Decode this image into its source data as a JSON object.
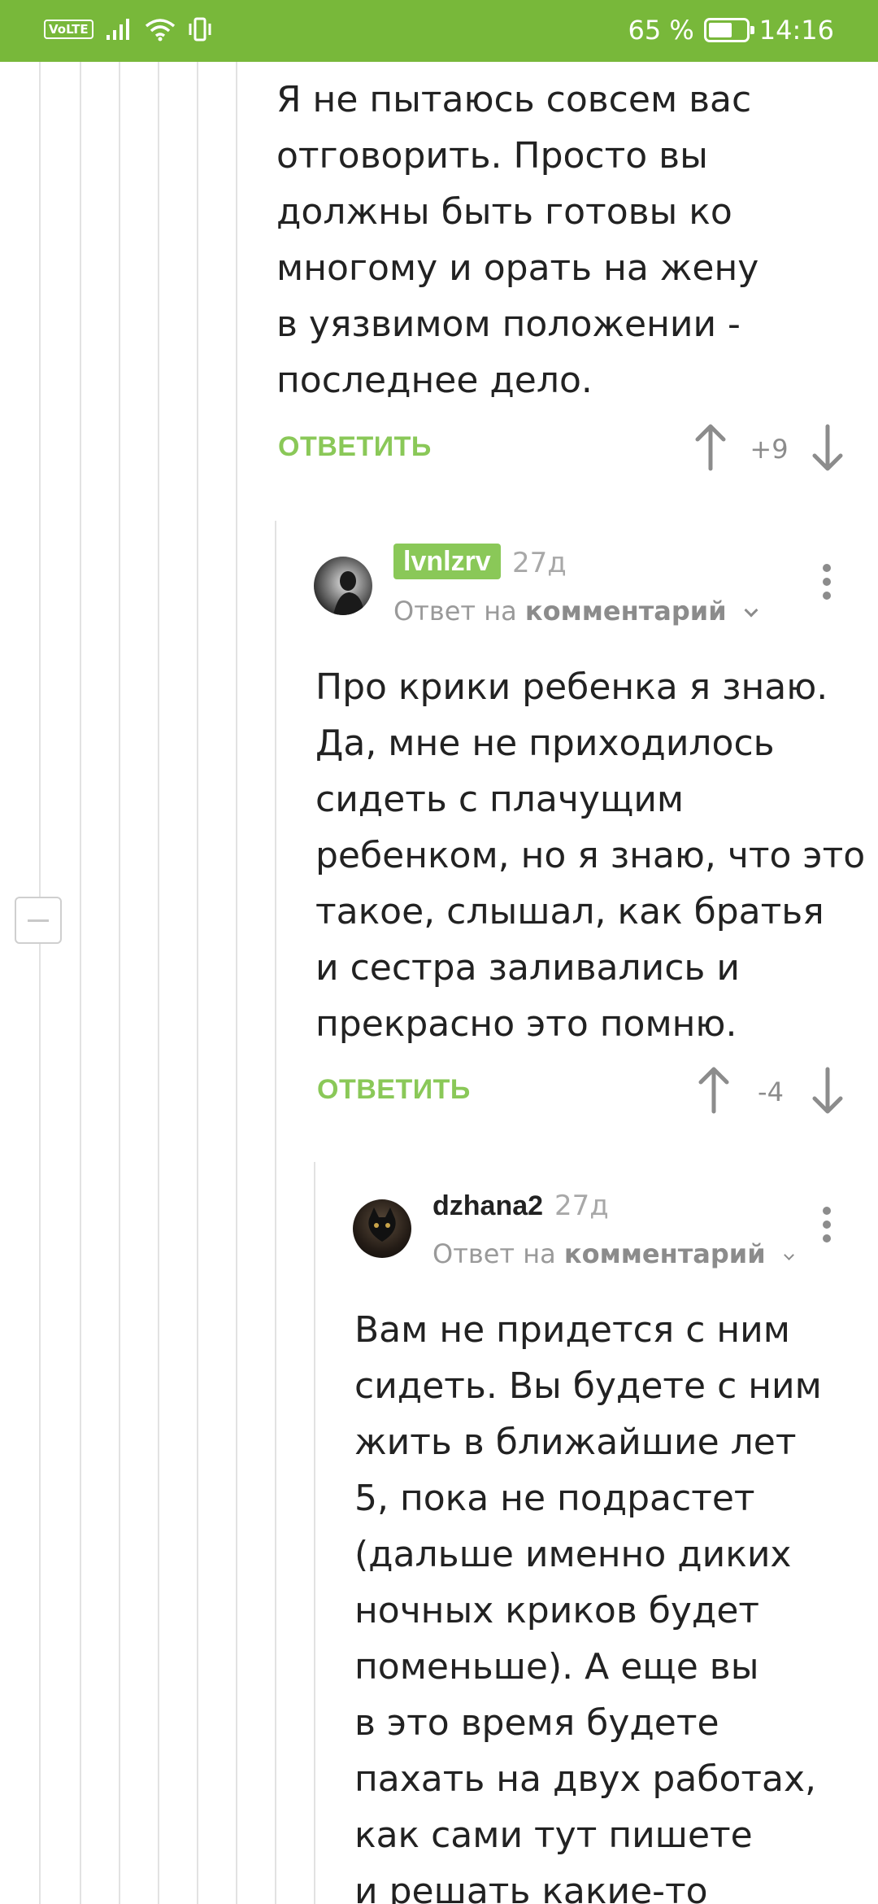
{
  "statusbar": {
    "volte": "VoLTE",
    "battery_percent": "65 %",
    "battery_level": 0.65,
    "time": "14:16",
    "icons": [
      "signal-icon",
      "wifi-icon",
      "vibrate-icon",
      "battery-icon"
    ]
  },
  "comments": [
    {
      "text": "Я не пытаюсь совсем вас\nотговорить. Просто вы\nдолжны быть готовы ко\nмногому и орать на жену\nв уязвимом положении -\nпоследнее дело.",
      "reply_label": "ОТВЕТИТЬ",
      "score": "+9"
    },
    {
      "author": "lvnlzrv",
      "time": "27д",
      "reply_to_prefix": "Ответ на",
      "reply_to_link": "комментарий",
      "text": "Про крики ребенка я знаю.\nДа, мне не приходилось\nсидеть с плачущим\nребенком, но я знаю, что это\nтакое, слышал, как братья\nи сестра заливались и\nпрекрасно это помню.",
      "reply_label": "ОТВЕТИТЬ",
      "score": "-4"
    },
    {
      "author": "dzhana2",
      "time": "27д",
      "reply_to_prefix": "Ответ на",
      "reply_to_link": "комментарий",
      "text": "Вам не придется с ним\nсидеть. Вы будете с ним\nжить в ближайшие лет\n5, пока не подрастет\n(дальше именно диких\nночных криков будет\nпоменьше). А еще вы\nв это время будете\nпахать на двух работах,\nкак сами тут пишете\nи решать какие-то"
    }
  ],
  "colors": {
    "accent": "#78b83a",
    "reply": "#8ac858",
    "muted": "#8c8c8c"
  }
}
